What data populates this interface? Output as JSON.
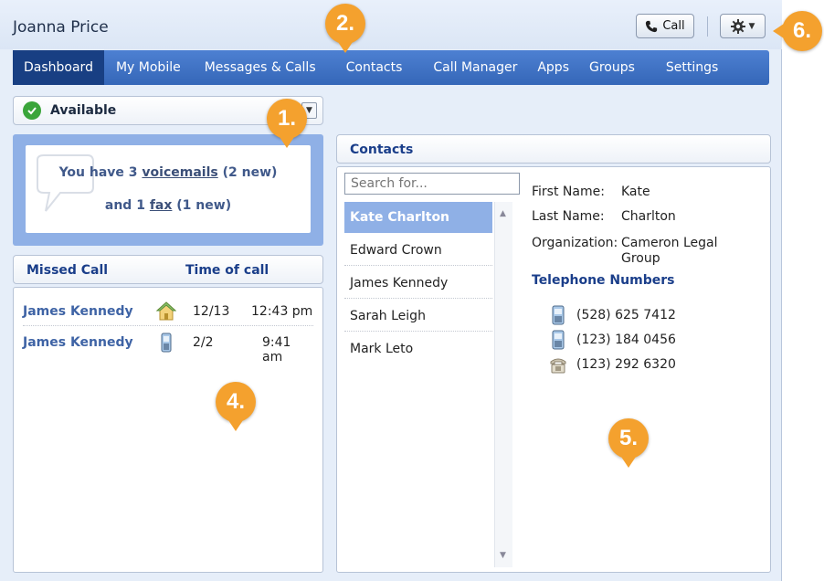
{
  "header": {
    "user_name": "Joanna Price",
    "call_button_label": "Call"
  },
  "nav": {
    "tabs": [
      {
        "label": "Dashboard",
        "active": true
      },
      {
        "label": "My Mobile"
      },
      {
        "label": "Messages & Calls"
      },
      {
        "label": "Contacts"
      },
      {
        "label": "Call Manager"
      },
      {
        "label": "Apps"
      },
      {
        "label": "Groups"
      },
      {
        "label": "Settings"
      }
    ]
  },
  "presence": {
    "status": "Available"
  },
  "messages": {
    "prefix": "You have 3 ",
    "voicemails_link": "voicemails",
    "voicemails_suffix": " (2 new)",
    "and": "and 1 ",
    "fax_link": "fax",
    "fax_suffix": " (1 new)"
  },
  "missed_calls": {
    "col_name": "Missed Call",
    "col_time": "Time of call",
    "rows": [
      {
        "name": "James Kennedy",
        "type_icon": "home-phone-icon",
        "date": "12/13",
        "time": "12:43 pm"
      },
      {
        "name": "James Kennedy",
        "type_icon": "mobile-phone-icon",
        "date": "2/2",
        "time": "9:41 am"
      }
    ]
  },
  "contacts": {
    "title": "Contacts",
    "search_placeholder": "Search for...",
    "list": [
      "Kate Charlton",
      "Edward Crown",
      "James Kennedy",
      "Sarah Leigh",
      "Mark Leto"
    ],
    "selected": "Kate Charlton",
    "detail": {
      "first_name_label": "First Name:",
      "first_name": "Kate",
      "last_name_label": "Last Name:",
      "last_name": "Charlton",
      "org_label": "Organization:",
      "org_line1": "Cameron Legal",
      "org_line2": "Group",
      "phones_title": "Telephone Numbers",
      "phones": [
        {
          "number": "(528) 625 7412",
          "icon": "mobile-phone-icon"
        },
        {
          "number": "(123) 184 0456",
          "icon": "mobile-phone-icon"
        },
        {
          "number": "(123) 292 6320",
          "icon": "desk-phone-icon"
        }
      ]
    }
  },
  "markers": [
    "1.",
    "2.",
    "4.",
    "5.",
    "6."
  ],
  "colors": {
    "nav_bg": "#3e72c6",
    "nav_active": "#183f83",
    "accent_blue": "#1a3e8a",
    "marker_orange": "#f4a12e",
    "available_green": "#3aa53a",
    "card_blue": "#8fb0e6"
  }
}
